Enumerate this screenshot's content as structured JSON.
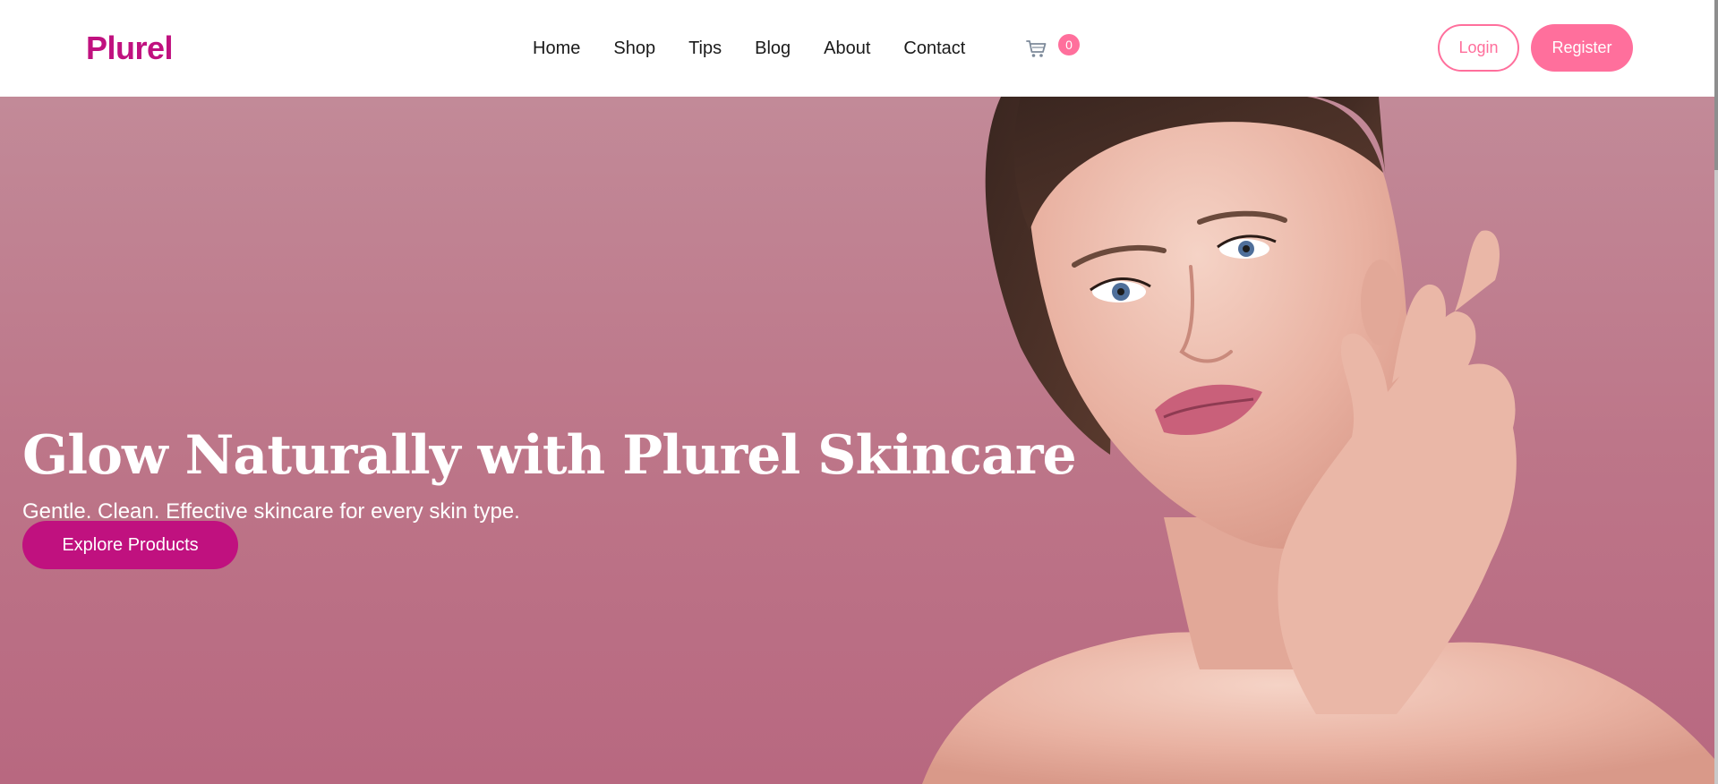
{
  "brand": {
    "logo": "Plurel",
    "primary_color": "#c0117f",
    "accent_color": "#ff6f9c"
  },
  "nav": {
    "links": [
      "Home",
      "Shop",
      "Tips",
      "Blog",
      "About",
      "Contact"
    ],
    "cart_icon": "shopping-cart-icon",
    "cart_count": "0"
  },
  "auth": {
    "login_label": "Login",
    "register_label": "Register"
  },
  "hero": {
    "title": "Glow Naturally with Plurel Skincare",
    "subtitle": "Gentle. Clean. Effective skincare for every skin type.",
    "cta_label": "Explore Products",
    "background_color": "#bd7689"
  }
}
